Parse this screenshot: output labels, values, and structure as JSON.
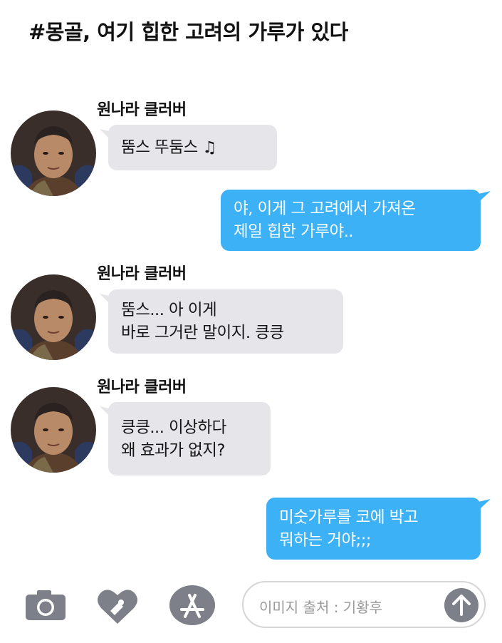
{
  "title": "#몽골, 여기 힙한 고려의 가루가 있다",
  "messages": [
    {
      "direction": "in",
      "sender": "원나라 클러버",
      "lines": [
        "뚬스 뚜둠스 ♫"
      ]
    },
    {
      "direction": "out",
      "lines": [
        "야, 이게 그 고려에서 가져온",
        "제일 힙한 가루야.."
      ]
    },
    {
      "direction": "in",
      "sender": "원나라 클러버",
      "lines": [
        "뚬스... 아 이게",
        "바로 그거란 말이지. 킁킁"
      ]
    },
    {
      "direction": "in",
      "sender": "원나라 클러버",
      "lines": [
        "킁킁... 이상하다",
        "왜 효과가 없지?"
      ]
    },
    {
      "direction": "out",
      "lines": [
        "미숫가루를 코에 박고",
        "뭐하는 거야;;;"
      ]
    }
  ],
  "input": {
    "text": "이미지 출처 : 기황후"
  },
  "icons": {
    "camera": "camera-icon",
    "digital_touch": "heart-touch-icon",
    "app_store": "app-store-icon",
    "send": "send-arrow-icon"
  },
  "colors": {
    "incoming_bubble": "#e6e6ea",
    "outgoing_bubble": "#3cb1f5",
    "icon_gray": "#7d8088"
  }
}
